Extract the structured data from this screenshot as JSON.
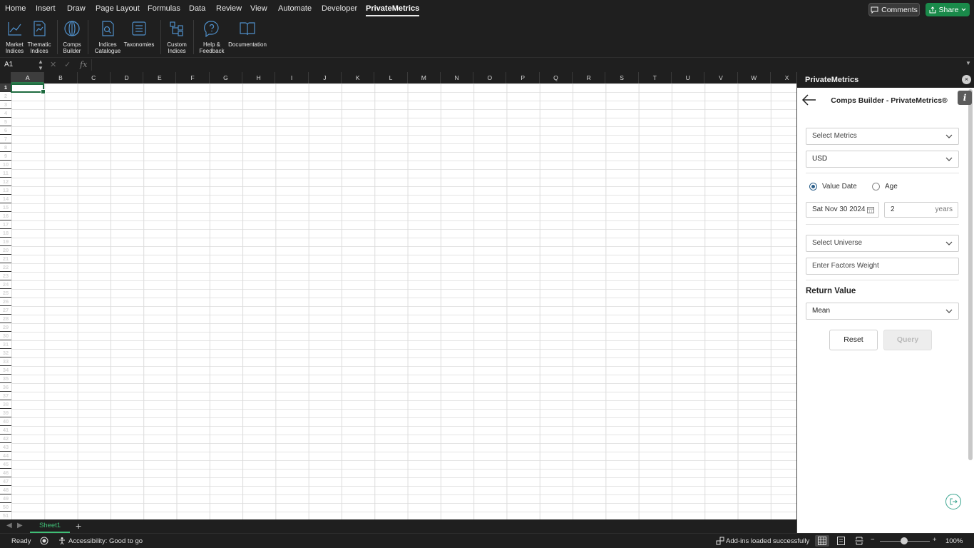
{
  "menubar": {
    "tabs": [
      {
        "label": "Home"
      },
      {
        "label": "Insert"
      },
      {
        "label": "Draw"
      },
      {
        "label": "Page Layout"
      },
      {
        "label": "Formulas"
      },
      {
        "label": "Data"
      },
      {
        "label": "Review"
      },
      {
        "label": "View"
      },
      {
        "label": "Automate"
      },
      {
        "label": "Developer"
      },
      {
        "label": "PrivateMetrics"
      }
    ],
    "active_tab": "PrivateMetrics",
    "comments_label": "Comments",
    "share_label": "Share"
  },
  "ribbon": {
    "buttons": [
      {
        "label": "Market\nIndices",
        "icon": "line-chart-icon"
      },
      {
        "label": "Thematic\nIndices",
        "icon": "document-chart-icon"
      },
      {
        "label": "Comps\nBuilder",
        "icon": "comps-circle-icon"
      },
      {
        "label": "Indices\nCatalogue",
        "icon": "search-document-icon"
      },
      {
        "label": "Taxonomies",
        "icon": "list-icon"
      },
      {
        "label": "Custom\nIndices",
        "icon": "hierarchy-icon"
      },
      {
        "label": "Help &\nFeedback",
        "icon": "help-bubble-icon"
      },
      {
        "label": "Documentation",
        "icon": "book-icon"
      }
    ]
  },
  "formulabar": {
    "cell_ref": "A1",
    "cancel_symbol": "✕",
    "enter_symbol": "✓",
    "fx_symbol": "fx"
  },
  "grid": {
    "columns": [
      "A",
      "B",
      "C",
      "D",
      "E",
      "F",
      "G",
      "H",
      "I",
      "J",
      "K",
      "L",
      "M",
      "N",
      "O",
      "P",
      "Q",
      "R",
      "S",
      "T",
      "U",
      "V",
      "W",
      "X"
    ],
    "selected_column": "A",
    "row_count": 51,
    "selected_row": 1
  },
  "sheets": {
    "tabs": [
      "Sheet1"
    ],
    "add_label": "+"
  },
  "statusbar": {
    "ready": "Ready",
    "accessibility": "Accessibility: Good to go",
    "addins": "Add-ins loaded successfully",
    "zoom": "100%",
    "zoom_minus": "−",
    "zoom_plus": "+"
  },
  "pane": {
    "header_title": "PrivateMetrics",
    "close_symbol": "×",
    "info_symbol": "i",
    "title": "Comps Builder - PrivateMetrics®",
    "select_metrics_placeholder": "Select Metrics",
    "currency": "USD",
    "radio_value_date": "Value Date",
    "radio_age": "Age",
    "selected_radio": "Value Date",
    "value_date": "Sat Nov 30 2024",
    "age_value": "2",
    "age_unit": "years",
    "select_universe_placeholder": "Select Universe",
    "factors_weight_placeholder": "Enter Factors Weight",
    "return_value_title": "Return Value",
    "return_value": "Mean",
    "reset_label": "Reset",
    "query_label": "Query"
  }
}
